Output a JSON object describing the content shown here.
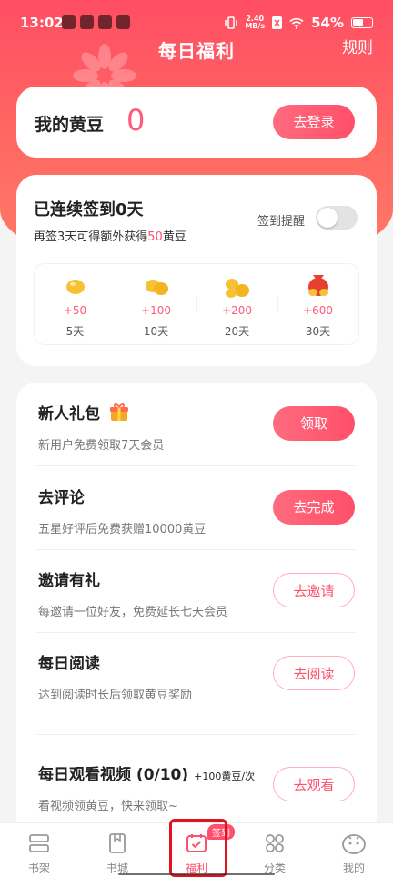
{
  "status_bar": {
    "time": "13:02",
    "net_speed": "2.40",
    "net_unit": "MB/s",
    "battery": "54%"
  },
  "header": {
    "title": "每日福利",
    "rules_label": "规则"
  },
  "beans": {
    "label": "我的黄豆",
    "count": "0",
    "login_label": "去登录"
  },
  "signin": {
    "title": "已连续签到0天",
    "subtitle_prefix": "再签3天可得额外获得",
    "subtitle_highlight": "50",
    "subtitle_suffix": "黄豆",
    "remind_label": "签到提醒",
    "remind_on": false,
    "milestones": [
      {
        "amount": "+50",
        "days": "5天",
        "icon": "single-bean-icon"
      },
      {
        "amount": "+100",
        "days": "10天",
        "icon": "two-beans-icon"
      },
      {
        "amount": "+200",
        "days": "20天",
        "icon": "bean-pile-icon"
      },
      {
        "amount": "+600",
        "days": "30天",
        "icon": "bean-bag-icon"
      }
    ]
  },
  "tasks": [
    {
      "name": "新人礼包",
      "desc": "新用户免费领取7天会员",
      "button": "领取",
      "style": "solid",
      "icon": "gift-icon"
    },
    {
      "name": "去评论",
      "desc": "五星好评后免费获赠10000黄豆",
      "button": "去完成",
      "style": "solid"
    },
    {
      "name": "邀请有礼",
      "desc": "每邀请一位好友，免费延长七天会员",
      "button": "去邀请",
      "style": "outline"
    },
    {
      "name": "每日阅读",
      "desc": "达到阅读时长后领取黄豆奖励",
      "button": "去阅读",
      "style": "outline"
    },
    {
      "name": "每日观看视频 (0/10)",
      "per": "+100黄豆/次",
      "desc": "看视频领黄豆，快来领取~",
      "button": "去观看",
      "style": "outline"
    }
  ],
  "tabbar": {
    "items": [
      {
        "label": "书架",
        "icon": "bookshelf-icon"
      },
      {
        "label": "书城",
        "icon": "bookstore-icon"
      },
      {
        "label": "福利",
        "icon": "calendar-check-icon",
        "active": true
      },
      {
        "label": "分类",
        "icon": "grid-icon"
      },
      {
        "label": "我的",
        "icon": "profile-icon"
      }
    ],
    "badge": "签到"
  },
  "colors": {
    "accent": "#ff4f6a",
    "hero_top": "#ff4e63",
    "hero_bottom": "#ff7a66",
    "bean": "#f6c233"
  }
}
